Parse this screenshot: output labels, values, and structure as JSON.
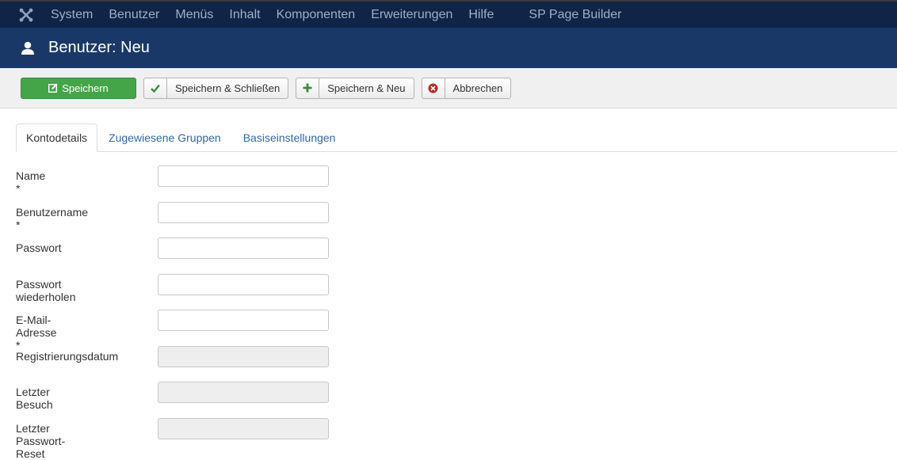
{
  "topnav": {
    "items": [
      "System",
      "Benutzer",
      "Menüs",
      "Inhalt",
      "Komponenten",
      "Erweiterungen",
      "Hilfe"
    ],
    "extra": "SP Page Builder"
  },
  "header": {
    "title": "Benutzer: Neu"
  },
  "toolbar": {
    "save": "Speichern",
    "save_close": "Speichern & Schließen",
    "save_new": "Speichern & Neu",
    "cancel": "Abbrechen"
  },
  "tabs": [
    "Kontodetails",
    "Zugewiesene Gruppen",
    "Basiseinstellungen"
  ],
  "form": {
    "fields": [
      {
        "label": "Name *",
        "value": "",
        "disabled": false
      },
      {
        "label": "Benutzername *",
        "value": "",
        "disabled": false
      },
      {
        "label": "Passwort",
        "value": "",
        "disabled": false
      },
      {
        "label": "Passwort wiederholen",
        "value": "",
        "disabled": false
      },
      {
        "label": "E-Mail-Adresse *",
        "value": "",
        "disabled": false
      },
      {
        "label": "Registrierungsdatum",
        "value": "",
        "disabled": true
      },
      {
        "label": "Letzter Besuch",
        "value": "",
        "disabled": true
      },
      {
        "label": "Letzter Passwort-Reset",
        "value": "",
        "disabled": true
      }
    ]
  },
  "colors": {
    "topnav_bg": "#0f2446",
    "header_bg": "#1a3867",
    "primary_button": "#44a548",
    "link": "#2f6aa6"
  },
  "icons": {
    "logo": "joomla-logo-icon",
    "header": "user-icon",
    "save": "edit-icon",
    "save_close": "check-icon",
    "save_new": "plus-icon",
    "cancel": "cancel-circle-icon"
  }
}
